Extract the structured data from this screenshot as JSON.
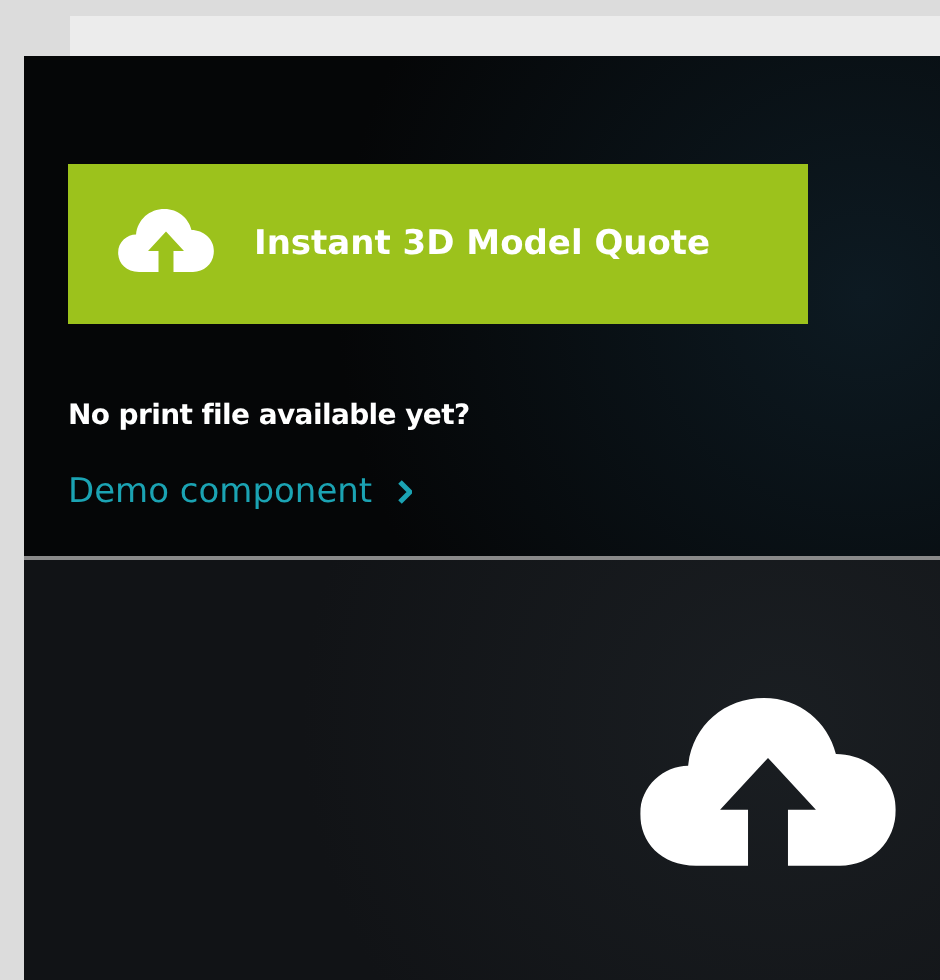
{
  "quote_button": {
    "label": "Instant 3D Model Quote"
  },
  "prompt": "No print file available yet?",
  "demo_link": {
    "label": "Demo component"
  }
}
